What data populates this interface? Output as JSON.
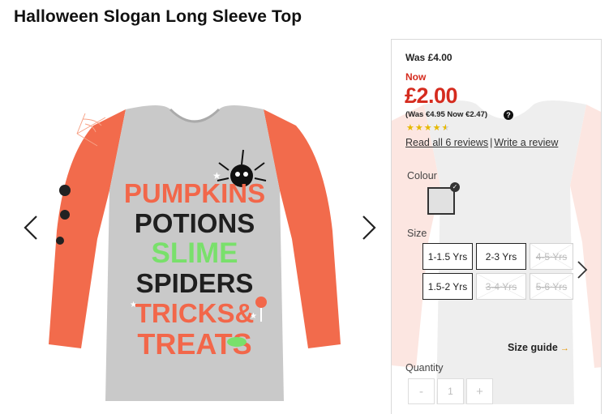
{
  "product": {
    "title": "Halloween Slogan Long Sleeve Top"
  },
  "gallery": {
    "slogan_lines": [
      "PUMPKINS",
      "POTIONS",
      "SLIME",
      "SPIDERS",
      "TRICKS&",
      "TREATS"
    ],
    "colors": {
      "sleeve": "#f26b4c",
      "body": "#c9c9c9",
      "pumpkins": "#f2674a",
      "potions": "#1f1f1f",
      "slime": "#79e06b",
      "spiders": "#1f1f1f",
      "tricks": "#f2674a",
      "treats": "#f2674a"
    },
    "prev_icon": "chevron-left-icon",
    "next_icon": "chevron-right-icon"
  },
  "pricing": {
    "was_label": "Was £4.00",
    "now_label": "Now",
    "price": "£2.00",
    "euro_note": "(Was €4.95 Now €2.47)",
    "help_glyph": "?",
    "sale_color": "#d52b1e"
  },
  "rating": {
    "stars_value": 4.5,
    "stars_max": 5,
    "read_reviews": "Read all 6 reviews",
    "separator": "|",
    "write_review": "Write a review"
  },
  "colour": {
    "label": "Colour",
    "swatch_color": "#e1e1e1",
    "selected_icon": "check-icon"
  },
  "sizes": {
    "label": "Size",
    "options": [
      {
        "label": "1-1.5 Yrs",
        "available": true
      },
      {
        "label": "2-3 Yrs",
        "available": true
      },
      {
        "label": "4-5 Yrs",
        "available": false
      },
      {
        "label": "1.5-2 Yrs",
        "available": true
      },
      {
        "label": "3-4 Yrs",
        "available": false
      },
      {
        "label": "5-6 Yrs",
        "available": false
      }
    ],
    "next_icon": "chevron-right-icon",
    "size_guide": "Size guide",
    "size_guide_arrow": "→"
  },
  "quantity": {
    "label": "Quantity",
    "minus": "-",
    "value": "1",
    "plus": "+"
  }
}
